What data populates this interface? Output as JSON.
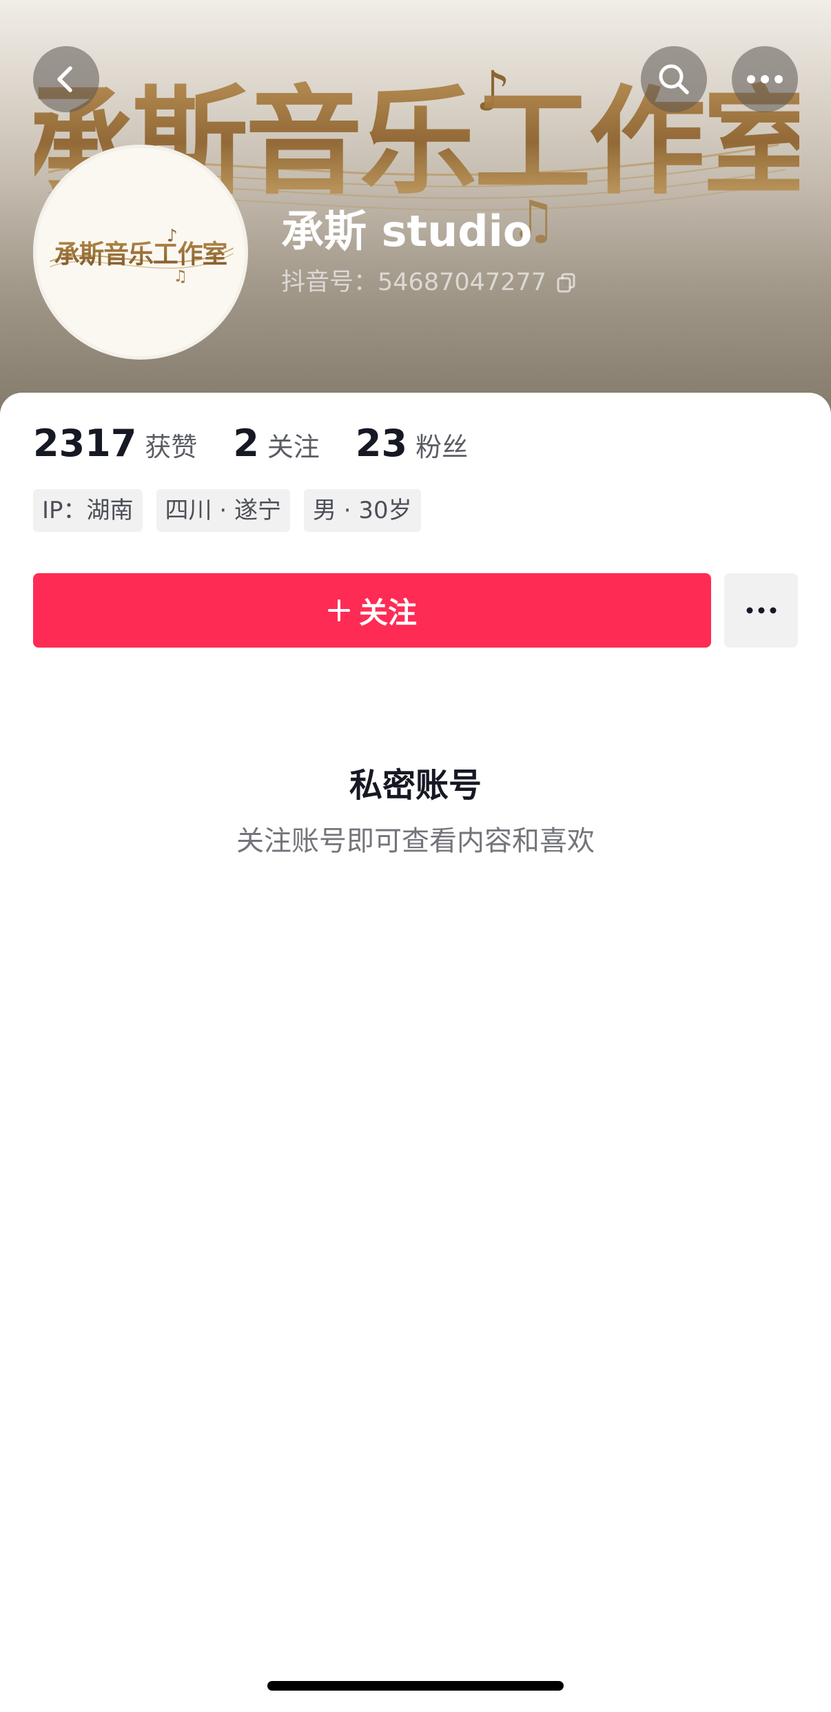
{
  "header": {
    "banner_text": "承斯音乐工作室",
    "back_icon": "chevron-left-icon",
    "search_icon": "search-icon",
    "more_icon": "ellipsis-icon"
  },
  "profile": {
    "avatar_text": "承斯音乐工作室",
    "name": "承斯 studio",
    "douyin_id_label": "抖音号：",
    "douyin_id": "54687047277",
    "copy_icon": "copy-icon"
  },
  "stats": [
    {
      "value": "2317",
      "label": "获赞"
    },
    {
      "value": "2",
      "label": "关注"
    },
    {
      "value": "23",
      "label": "粉丝"
    }
  ],
  "tags": [
    "IP：湖南",
    "四川 · 遂宁",
    "男 · 30岁"
  ],
  "actions": {
    "follow_label": "关注",
    "follow_icon": "plus-icon",
    "more_icon": "ellipsis-icon"
  },
  "private_notice": {
    "title": "私密账号",
    "subtitle": "关注账号即可查看内容和喜欢"
  },
  "colors": {
    "accent": "#fe2c55",
    "text_primary": "#161823",
    "tag_bg": "#f1f1f2"
  }
}
